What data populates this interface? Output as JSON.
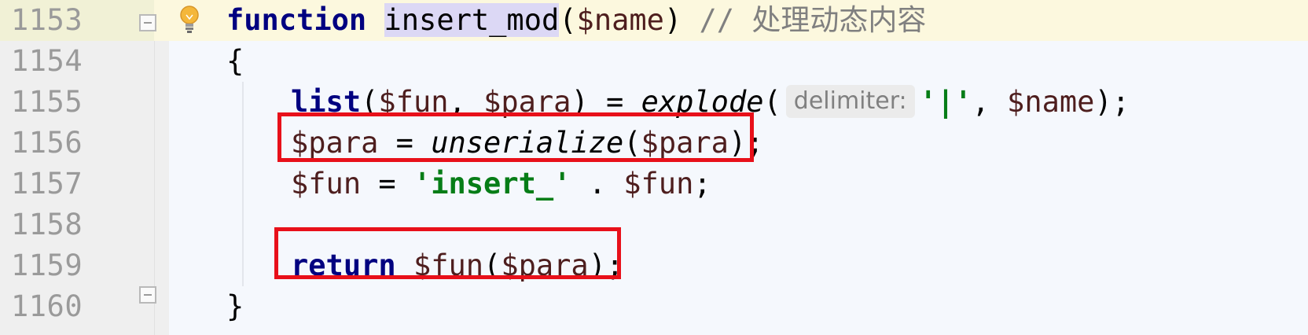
{
  "editor": {
    "lines": [
      {
        "number": "1153",
        "kw": "function",
        "name": "insert_mod",
        "open": "(",
        "param": "$name",
        "close": ")",
        "comment": "// 处理动态内容"
      },
      {
        "number": "1154",
        "text": "{"
      },
      {
        "number": "1155",
        "list": "list",
        "open": "(",
        "var1": "$fun",
        "sep": ", ",
        "var2": "$para",
        "close_eq": ") = ",
        "explode": "explode",
        "paren": "(",
        "hint": "delimiter:",
        "str": "'|'",
        "sep2": ", ",
        "var3": "$name",
        "end": ");"
      },
      {
        "number": "1156",
        "var1": "$para",
        "eq": " = ",
        "func": "unserialize",
        "open": "(",
        "var2": "$para",
        "end": ");"
      },
      {
        "number": "1157",
        "var1": "$fun",
        "eq": " = ",
        "str": "'insert_'",
        "dot": " . ",
        "var2": "$fun",
        "end": ";"
      },
      {
        "number": "1158"
      },
      {
        "number": "1159",
        "kw": "return",
        "var1": "$fun",
        "open": "(",
        "var2": "$para",
        "end": ");"
      },
      {
        "number": "1160",
        "text": "}"
      }
    ]
  },
  "colors": {
    "highlight_box": "#e8101a",
    "keyword": "#000080",
    "variable": "#660e7a",
    "string": "#067d17",
    "comment": "#808080",
    "current_line": "#fcf8de"
  },
  "icons": {
    "intention": "lightbulb-icon",
    "fold": "fold-marker-icon"
  }
}
